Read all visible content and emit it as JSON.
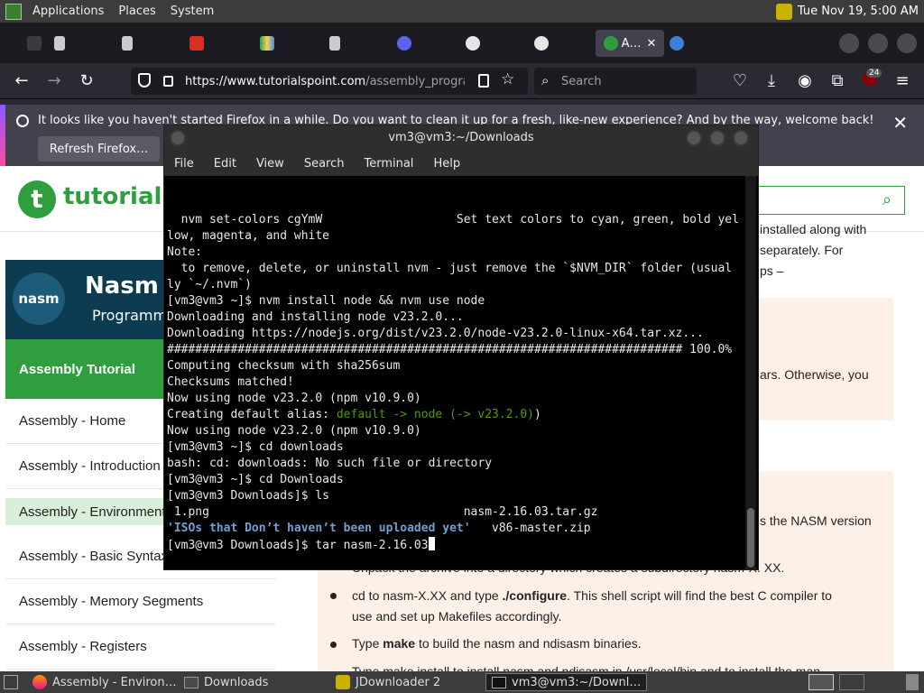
{
  "top_panel": {
    "menus": [
      "Applications",
      "Places",
      "System"
    ],
    "clock": "Tue Nov 19,  5:00 AM"
  },
  "browser": {
    "active_tab_label": "A…",
    "url_host": "https://www.tutorialspoint.com",
    "url_path": "/assembly_progra",
    "search_placeholder": "Search",
    "extension_badge": "24",
    "notification": {
      "message": "It looks like you haven't started Firefox in a while. Do you want to clean it up for a fresh, like-new experience? And by the way, welcome back!",
      "button": "Refresh Firefox…"
    }
  },
  "page": {
    "logo_text": "tutorials",
    "banner_title": "Nasm A",
    "banner_subtitle": "Programm",
    "banner_badge": "nasm",
    "sidebar_head": "Assembly Tutorial",
    "sidebar_items": [
      "Assembly - Home",
      "Assembly - Introduction",
      "Assembly - Environment",
      "Assembly - Basic Syntax",
      "Assembly - Memory Segments",
      "Assembly - Registers"
    ],
    "fragments": {
      "installed": "installed along with",
      "separately": "separately. For",
      "ps": "ps –",
      "otherwise": "ars. Otherwise, you",
      "nasm_version": "s the NASM version",
      "unpack": "Unpack the archive into a directory which creates a subdirectory nasm-X. XX.",
      "cd_prefix": "cd to nasm-X.XX and type ",
      "cd_configure": "./configure",
      "cd_suffix": ". This shell script will find the best C compiler to",
      "cd_line2": "use and set up Makefiles accordingly.",
      "type_prefix": "Type ",
      "type_make": "make",
      "type_suffix": " to build the nasm and ndisasm binaries.",
      "make_install": "Type make install to install nasm and ndisasm in /usr/local/bin and to install the man"
    }
  },
  "terminal": {
    "title": "vm3@vm3:~/Downloads",
    "menu": [
      "File",
      "Edit",
      "View",
      "Search",
      "Terminal",
      "Help"
    ],
    "lines": [
      "  nvm set-colors cgYmW                   Set text colors to cyan, green, bold yel",
      "low, magenta, and white",
      "",
      "Note:",
      "  to remove, delete, or uninstall nvm - just remove the `$NVM_DIR` folder (usual",
      "ly `~/.nvm`)",
      "",
      "[vm3@vm3 ~]$ nvm install node && nvm use node",
      "Downloading and installing node v23.2.0...",
      "Downloading https://nodejs.org/dist/v23.2.0/node-v23.2.0-linux-x64.tar.xz...",
      "######################################################################### 100.0%",
      "Computing checksum with sha256sum",
      "Checksums matched!",
      "Now using node v23.2.0 (npm v10.9.0)"
    ],
    "alias_prefix": "Creating default alias: ",
    "alias_default": "default -> node (-> v23.2.0)",
    "alias_suffix": ")",
    "lines2": [
      "Now using node v23.2.0 (npm v10.9.0)",
      "[vm3@vm3 ~]$ cd downloads",
      "bash: cd: downloads: No such file or directory",
      "[vm3@vm3 ~]$ cd Downloads",
      "[vm3@vm3 Downloads]$ ls"
    ],
    "ls_row1": " 1.png                                    nasm-2.16.03.tar.gz",
    "ls_row2_dir": "'ISOs that Don’t haven’t been uploaded yet'",
    "ls_row2_file": "   v86-master.zip",
    "prompt_line": "[vm3@vm3 Downloads]$ tar nasm-2.16.03"
  },
  "taskbar": {
    "items": [
      "Assembly - Environ…",
      "Downloads",
      "JDownloader 2",
      "vm3@vm3:~/Downl…"
    ]
  }
}
